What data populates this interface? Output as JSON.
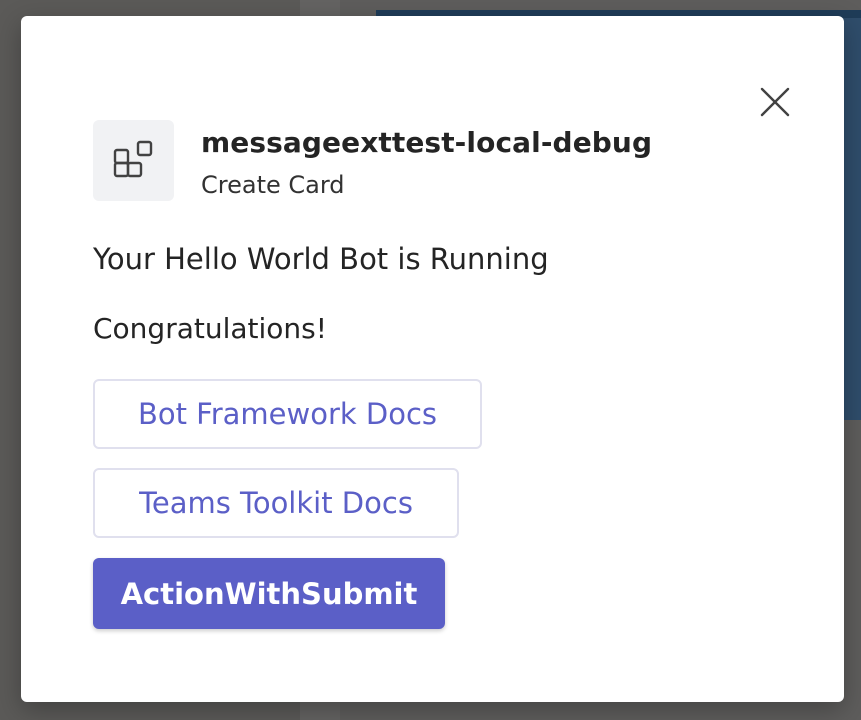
{
  "dialog": {
    "app_name": "messageexttest-local-debug",
    "subtitle": "Create Card",
    "close_icon": "close-icon",
    "app_icon": "apps-icon"
  },
  "card": {
    "heading": "Your Hello World Bot is Running",
    "text": "Congratulations!",
    "actions": [
      {
        "label": "Bot Framework Docs",
        "style": "secondary"
      },
      {
        "label": "Teams Toolkit Docs",
        "style": "secondary"
      },
      {
        "label": "ActionWithSubmit",
        "style": "primary"
      }
    ]
  },
  "colors": {
    "accent": "#5b5fc7",
    "text": "#242424",
    "backdrop": "#5b5a58"
  }
}
